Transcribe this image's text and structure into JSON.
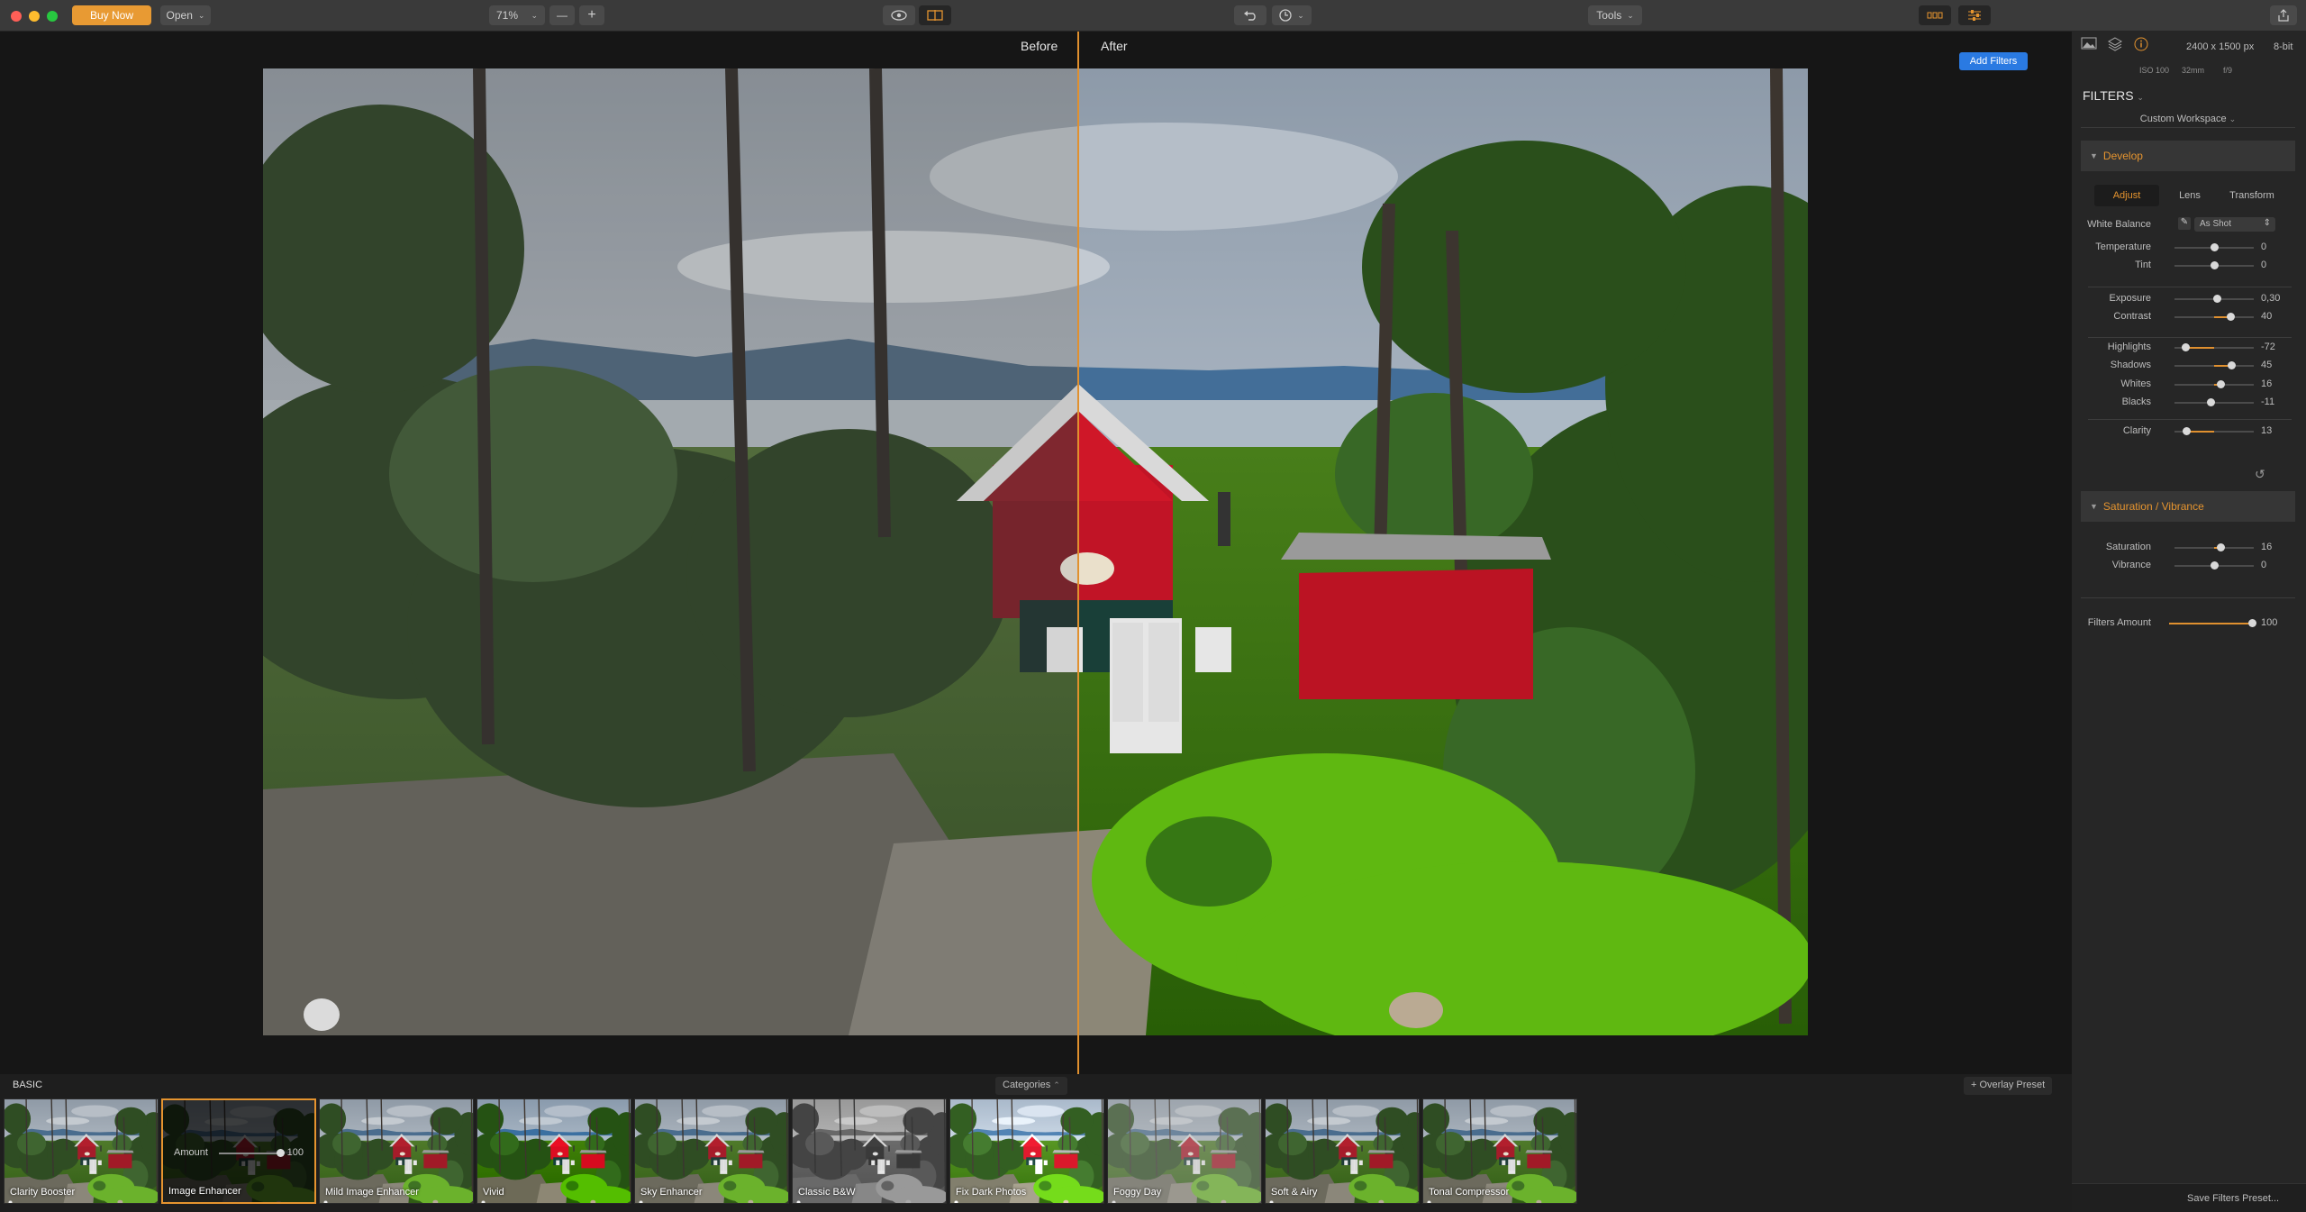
{
  "toolbar": {
    "buy_label": "Buy Now",
    "open_label": "Open",
    "zoom_value": "71%",
    "zoom_out": "—",
    "zoom_in": "+",
    "tools_label": "Tools"
  },
  "canvas": {
    "before_label": "Before",
    "after_label": "After"
  },
  "info": {
    "dimensions": "2400 x 1500 px",
    "bit_depth": "8-bit",
    "iso": "ISO 100",
    "focal": "32mm",
    "aperture": "f/9"
  },
  "filters": {
    "title": "FILTERS",
    "add_label": "Add Filters",
    "workspace": "Custom Workspace"
  },
  "develop": {
    "title": "Develop",
    "tabs": [
      "Adjust",
      "Lens",
      "Transform"
    ],
    "white_balance_label": "White Balance",
    "white_balance_value": "As Shot",
    "sliders": [
      {
        "name": "Temperature",
        "value": "0",
        "pos": 0.5
      },
      {
        "name": "Tint",
        "value": "0",
        "pos": 0.5
      },
      {
        "name": "Exposure",
        "value": "0,30",
        "pos": 0.53
      },
      {
        "name": "Contrast",
        "value": "40",
        "pos": 0.7
      },
      {
        "name": "Highlights",
        "value": "-72",
        "pos": 0.14
      },
      {
        "name": "Shadows",
        "value": "45",
        "pos": 0.72
      },
      {
        "name": "Whites",
        "value": "16",
        "pos": 0.58
      },
      {
        "name": "Blacks",
        "value": "-11",
        "pos": 0.45
      },
      {
        "name": "Clarity",
        "value": "13",
        "pos": 0.15
      }
    ]
  },
  "saturation": {
    "title": "Saturation / Vibrance",
    "sliders": [
      {
        "name": "Saturation",
        "value": "16",
        "pos": 0.58
      },
      {
        "name": "Vibrance",
        "value": "0",
        "pos": 0.5
      }
    ]
  },
  "filters_amount": {
    "name": "Filters Amount",
    "value": "100",
    "pos": 1.0
  },
  "save_label": "Save Filters Preset...",
  "bottom": {
    "section": "BASIC",
    "categories": "Categories",
    "overlay": "+ Overlay Preset",
    "amount_label": "Amount",
    "amount_value": "100",
    "presets": [
      {
        "name": "Clarity Booster",
        "style": "normal"
      },
      {
        "name": "Image Enhancer",
        "style": "dark"
      },
      {
        "name": "Mild Image Enhancer",
        "style": "normal"
      },
      {
        "name": "Vivid",
        "style": "vivid"
      },
      {
        "name": "Sky Enhancer",
        "style": "normal"
      },
      {
        "name": "Classic B&W",
        "style": "bw"
      },
      {
        "name": "Fix Dark Photos",
        "style": "bright"
      },
      {
        "name": "Foggy Day",
        "style": "foggy"
      },
      {
        "name": "Soft & Airy",
        "style": "normal"
      },
      {
        "name": "Tonal Compressor",
        "style": "normal"
      }
    ]
  },
  "colors": {
    "accent": "#e5942f",
    "blue": "#2a7ae2",
    "buy": "#e89a33"
  }
}
